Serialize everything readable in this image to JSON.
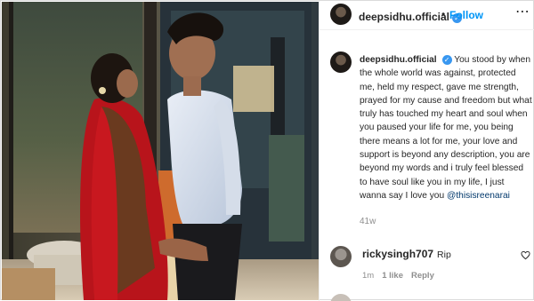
{
  "post": {
    "username": "deepsidhu.official",
    "follow_label": "Follow",
    "more_icon": "more-options-icon",
    "caption_text": "You stood by when the whole world was against, protected me, held my respect, gave me strength, prayed for my cause and freedom but what truly has touched my heart and soul when you paused your life for me, you being there means a lot for me, your love and support is beyond any description, you are beyond my words and i truly feel blessed to have soul like you in my life, I just wanna say I love you",
    "caption_mention": "@thisisreenarai",
    "time_ago": "41w"
  },
  "comment": {
    "username": "rickysingh707",
    "text": "Rip",
    "time": "1m",
    "likes": "1 like",
    "reply": "Reply"
  },
  "colors": {
    "follow": "#0095f6",
    "verified": "#3897f0",
    "mention": "#00376b",
    "muted": "#8e8e8e"
  }
}
